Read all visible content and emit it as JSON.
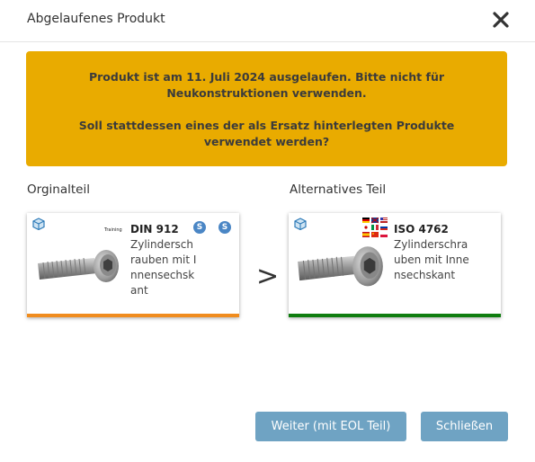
{
  "dialog": {
    "title": "Abgelaufenes Produkt"
  },
  "warning": {
    "line1": "Produkt ist am 11. Juli 2024 ausgelaufen. Bitte nicht für Neukonstruktionen verwenden.",
    "line2": "Soll stattdessen eines der als Ersatz hinterlegten Produkte verwendet werden?",
    "color": "#e9ab00"
  },
  "original": {
    "section_label": "Orginalteil",
    "badge": "Training",
    "name": "DIN 912",
    "description": "Zylinderschrauben mit Innensechskant",
    "status_color": "#f08c1e",
    "icons": [
      "cube-icon",
      "screw-bolt-image",
      "s-badge-icon",
      "s-badge-icon"
    ]
  },
  "alternative": {
    "section_label": "Alternatives Teil",
    "name": "ISO 4762",
    "description": "Zylinderschrauben mit Innensechskant",
    "status_color": "#0f7d0f",
    "icons": [
      "cube-icon",
      "screw-bolt-image",
      "flags-icon"
    ]
  },
  "arrow": ">",
  "buttons": {
    "continue": "Weiter (mit EOL Teil)",
    "close": "Schließen"
  }
}
